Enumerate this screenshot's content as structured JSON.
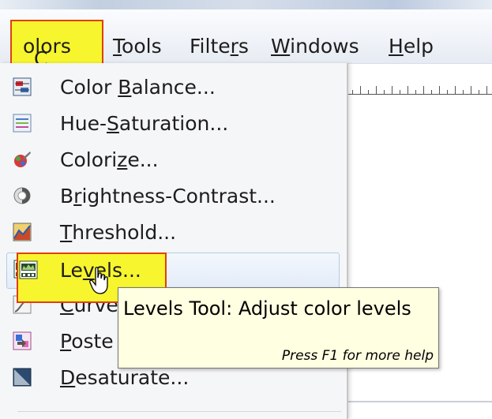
{
  "menubar": {
    "items": [
      {
        "label": "Colors",
        "active": true
      },
      {
        "label": "Tools"
      },
      {
        "label": "Filters"
      },
      {
        "label": "Windows"
      },
      {
        "label": "Help"
      }
    ]
  },
  "dropdown": {
    "items": [
      {
        "label": "Color Balance...",
        "icon": "color-balance-icon"
      },
      {
        "label": "Hue-Saturation...",
        "icon": "hue-saturation-icon"
      },
      {
        "label": "Colorize...",
        "icon": "colorize-icon"
      },
      {
        "label": "Brightness-Contrast...",
        "icon": "brightness-contrast-icon"
      },
      {
        "label": "Threshold...",
        "icon": "threshold-icon"
      },
      {
        "label": "Levels...",
        "icon": "levels-icon",
        "hovered": true
      },
      {
        "label": "Curves...",
        "icon": "curves-icon",
        "visible_text": "Curve"
      },
      {
        "label": "Posterize...",
        "icon": "posterize-icon",
        "visible_text": "Poste"
      },
      {
        "label": "Desaturate...",
        "icon": "desaturate-icon"
      }
    ]
  },
  "tooltip": {
    "title": "Levels Tool: Adjust color levels",
    "help": "Press F1 for more help"
  },
  "colors": {
    "highlight": "#f7f52e",
    "highlight_border": "#e04010",
    "tooltip_bg": "#ffffe1",
    "menu_bg": "#f5f6f7"
  }
}
